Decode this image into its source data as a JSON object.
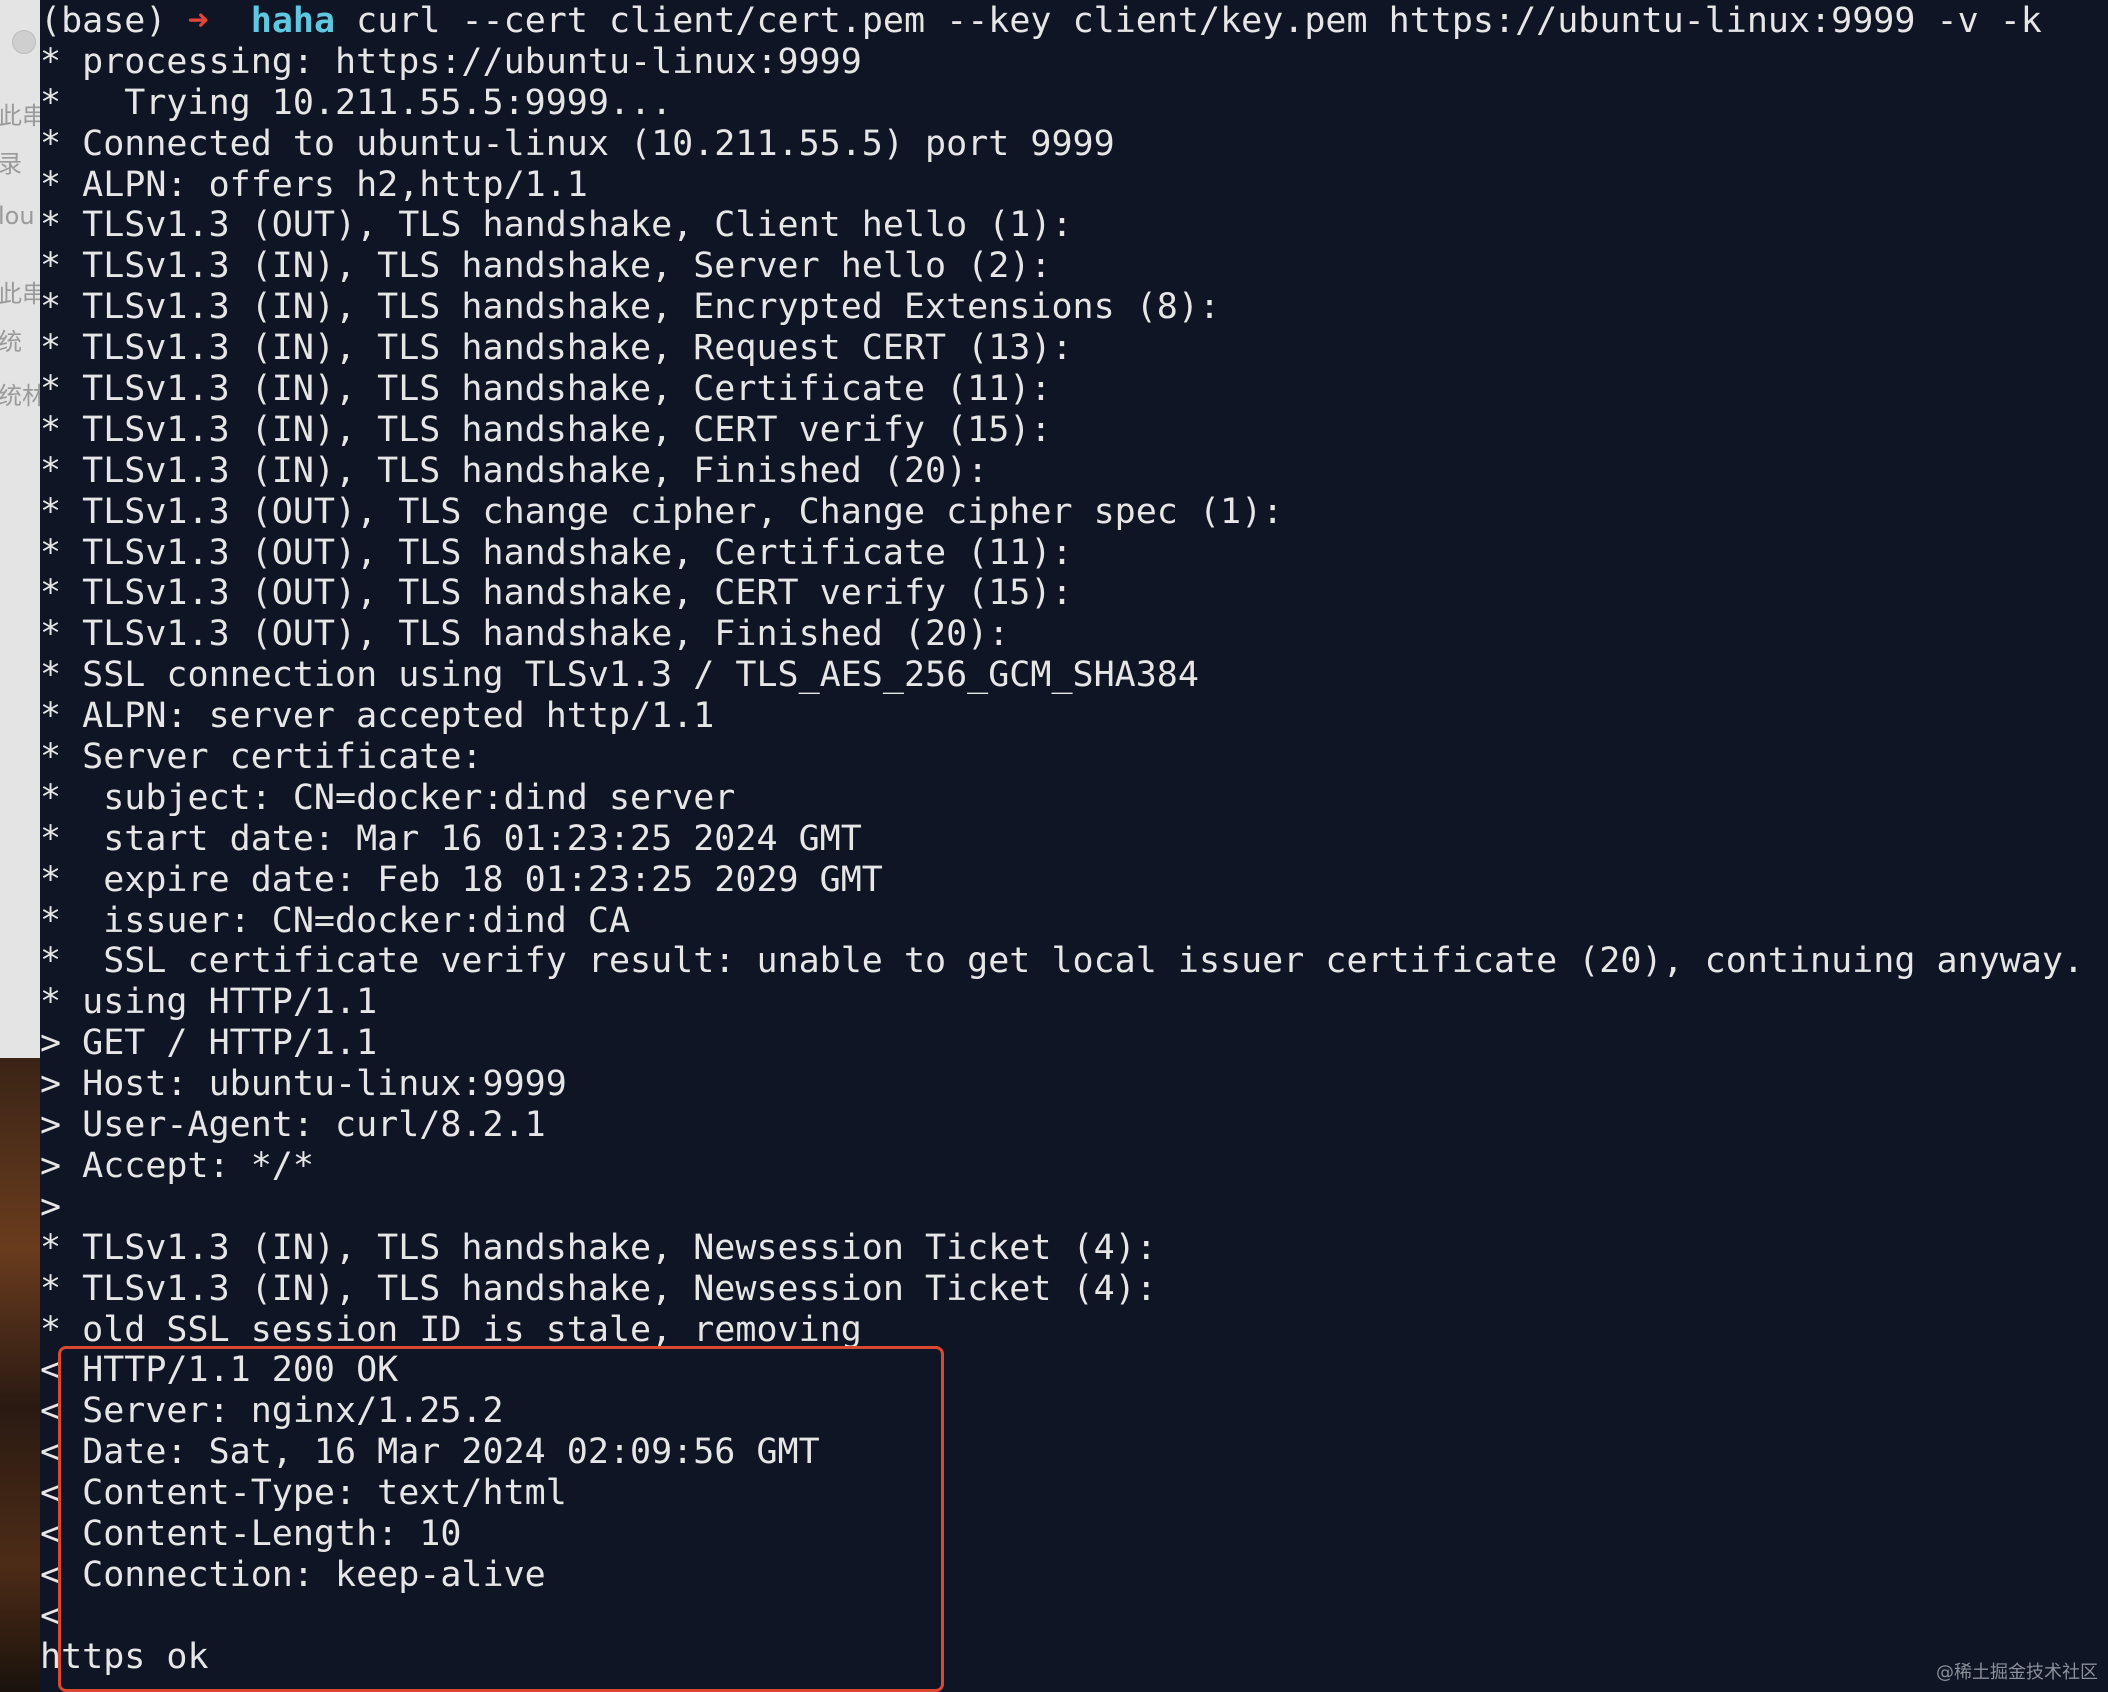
{
  "sidebar_fragments": {
    "labels": [
      "此串",
      "录",
      "lou",
      "此串",
      "统",
      "统林"
    ]
  },
  "terminal": {
    "prompt": {
      "env": "(base)",
      "arrow": "➜",
      "directory": "haha",
      "command": "curl --cert client/cert.pem --key client/key.pem https://ubuntu-linux:9999 -v -k"
    },
    "lines": [
      "* processing: https://ubuntu-linux:9999",
      "*   Trying 10.211.55.5:9999...",
      "* Connected to ubuntu-linux (10.211.55.5) port 9999",
      "* ALPN: offers h2,http/1.1",
      "* TLSv1.3 (OUT), TLS handshake, Client hello (1):",
      "* TLSv1.3 (IN), TLS handshake, Server hello (2):",
      "* TLSv1.3 (IN), TLS handshake, Encrypted Extensions (8):",
      "* TLSv1.3 (IN), TLS handshake, Request CERT (13):",
      "* TLSv1.3 (IN), TLS handshake, Certificate (11):",
      "* TLSv1.3 (IN), TLS handshake, CERT verify (15):",
      "* TLSv1.3 (IN), TLS handshake, Finished (20):",
      "* TLSv1.3 (OUT), TLS change cipher, Change cipher spec (1):",
      "* TLSv1.3 (OUT), TLS handshake, Certificate (11):",
      "* TLSv1.3 (OUT), TLS handshake, CERT verify (15):",
      "* TLSv1.3 (OUT), TLS handshake, Finished (20):",
      "* SSL connection using TLSv1.3 / TLS_AES_256_GCM_SHA384",
      "* ALPN: server accepted http/1.1",
      "* Server certificate:",
      "*  subject: CN=docker:dind server",
      "*  start date: Mar 16 01:23:25 2024 GMT",
      "*  expire date: Feb 18 01:23:25 2029 GMT",
      "*  issuer: CN=docker:dind CA",
      "*  SSL certificate verify result: unable to get local issuer certificate (20), continuing anyway.",
      "* using HTTP/1.1",
      "> GET / HTTP/1.1",
      "> Host: ubuntu-linux:9999",
      "> User-Agent: curl/8.2.1",
      "> Accept: */*",
      ">",
      "* TLSv1.3 (IN), TLS handshake, Newsession Ticket (4):",
      "* TLSv1.3 (IN), TLS handshake, Newsession Ticket (4):",
      "* old SSL session ID is stale, removing",
      "< HTTP/1.1 200 OK",
      "< Server: nginx/1.25.2",
      "< Date: Sat, 16 Mar 2024 02:09:56 GMT",
      "< Content-Type: text/html",
      "< Content-Length: 10",
      "< Connection: keep-alive",
      "<",
      "https ok"
    ]
  },
  "watermark": "@稀土掘金技术社区",
  "colors": {
    "terminal_background": "#0f1525",
    "text": "#e6e6e6",
    "prompt_arrow": "#e0463a",
    "prompt_directory": "#5fc8e0",
    "highlight_border": "#d9492f"
  }
}
